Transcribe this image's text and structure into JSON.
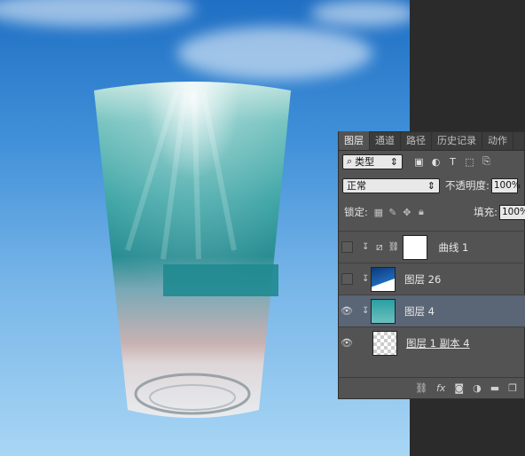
{
  "tabs": [
    "图层",
    "通道",
    "路径",
    "历史记录",
    "动作"
  ],
  "filter": {
    "kind": "类型",
    "icons": [
      "image-filter-icon",
      "adjustment-filter-icon",
      "type-filter-icon",
      "shape-filter-icon",
      "smart-object-filter-icon"
    ]
  },
  "blend": {
    "mode": "正常",
    "opacity_label": "不透明度:",
    "opacity_value": "100%"
  },
  "lock": {
    "label": "锁定:",
    "fill_label": "填充:",
    "fill_value": "100%"
  },
  "layers": [
    {
      "name": "曲线 1",
      "visible": false,
      "type": "adjustment-curves"
    },
    {
      "name": "图层 26",
      "visible": false,
      "type": "smart-object"
    },
    {
      "name": "图层 4",
      "visible": true,
      "selected": true,
      "type": "smart-object"
    },
    {
      "name": "图层 1 副本 4",
      "visible": true,
      "type": "raster"
    }
  ],
  "bottom_icons": [
    "link-icon",
    "fx-icon",
    "mask-icon",
    "adjustment-icon",
    "folder-icon",
    "new-layer-icon"
  ],
  "colors": {
    "panel": "#535353",
    "selected_layer": "#5a6576",
    "sky_top": "#1f6fc4",
    "sky_bottom": "#a8d6f4",
    "water": "#2e9aa0"
  }
}
